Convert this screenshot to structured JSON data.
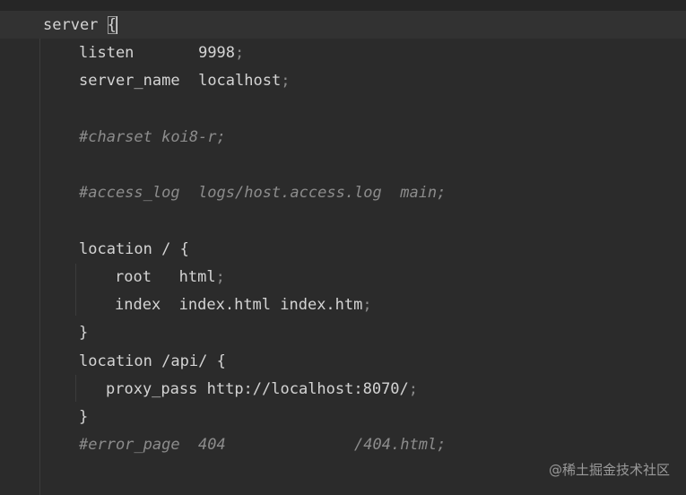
{
  "code": {
    "server_kw": "server",
    "server_brace": "{",
    "listen_kw": "listen",
    "listen_pad": "       ",
    "listen_val": "9998",
    "server_name_kw": "server_name",
    "server_name_pad": "  ",
    "server_name_val": "localhost",
    "charset_comment": "#charset koi8-r;",
    "access_log_comment": "#access_log  logs/host.access.log  main;",
    "location1_kw": "location",
    "location1_path": "/",
    "open_brace": "{",
    "root_kw": "root",
    "root_pad": "   ",
    "root_val": "html",
    "index_kw": "index",
    "index_pad": "  ",
    "index_val": "index.html index.htm",
    "close_brace": "}",
    "location2_kw": "location",
    "location2_path": "/api/",
    "proxy_kw": "proxy_pass",
    "proxy_val": "http://localhost:8070/",
    "error_page_comment": "#error_page  404              /404.html;",
    "semicolon": ";"
  },
  "watermark": "@稀土掘金技术社区"
}
